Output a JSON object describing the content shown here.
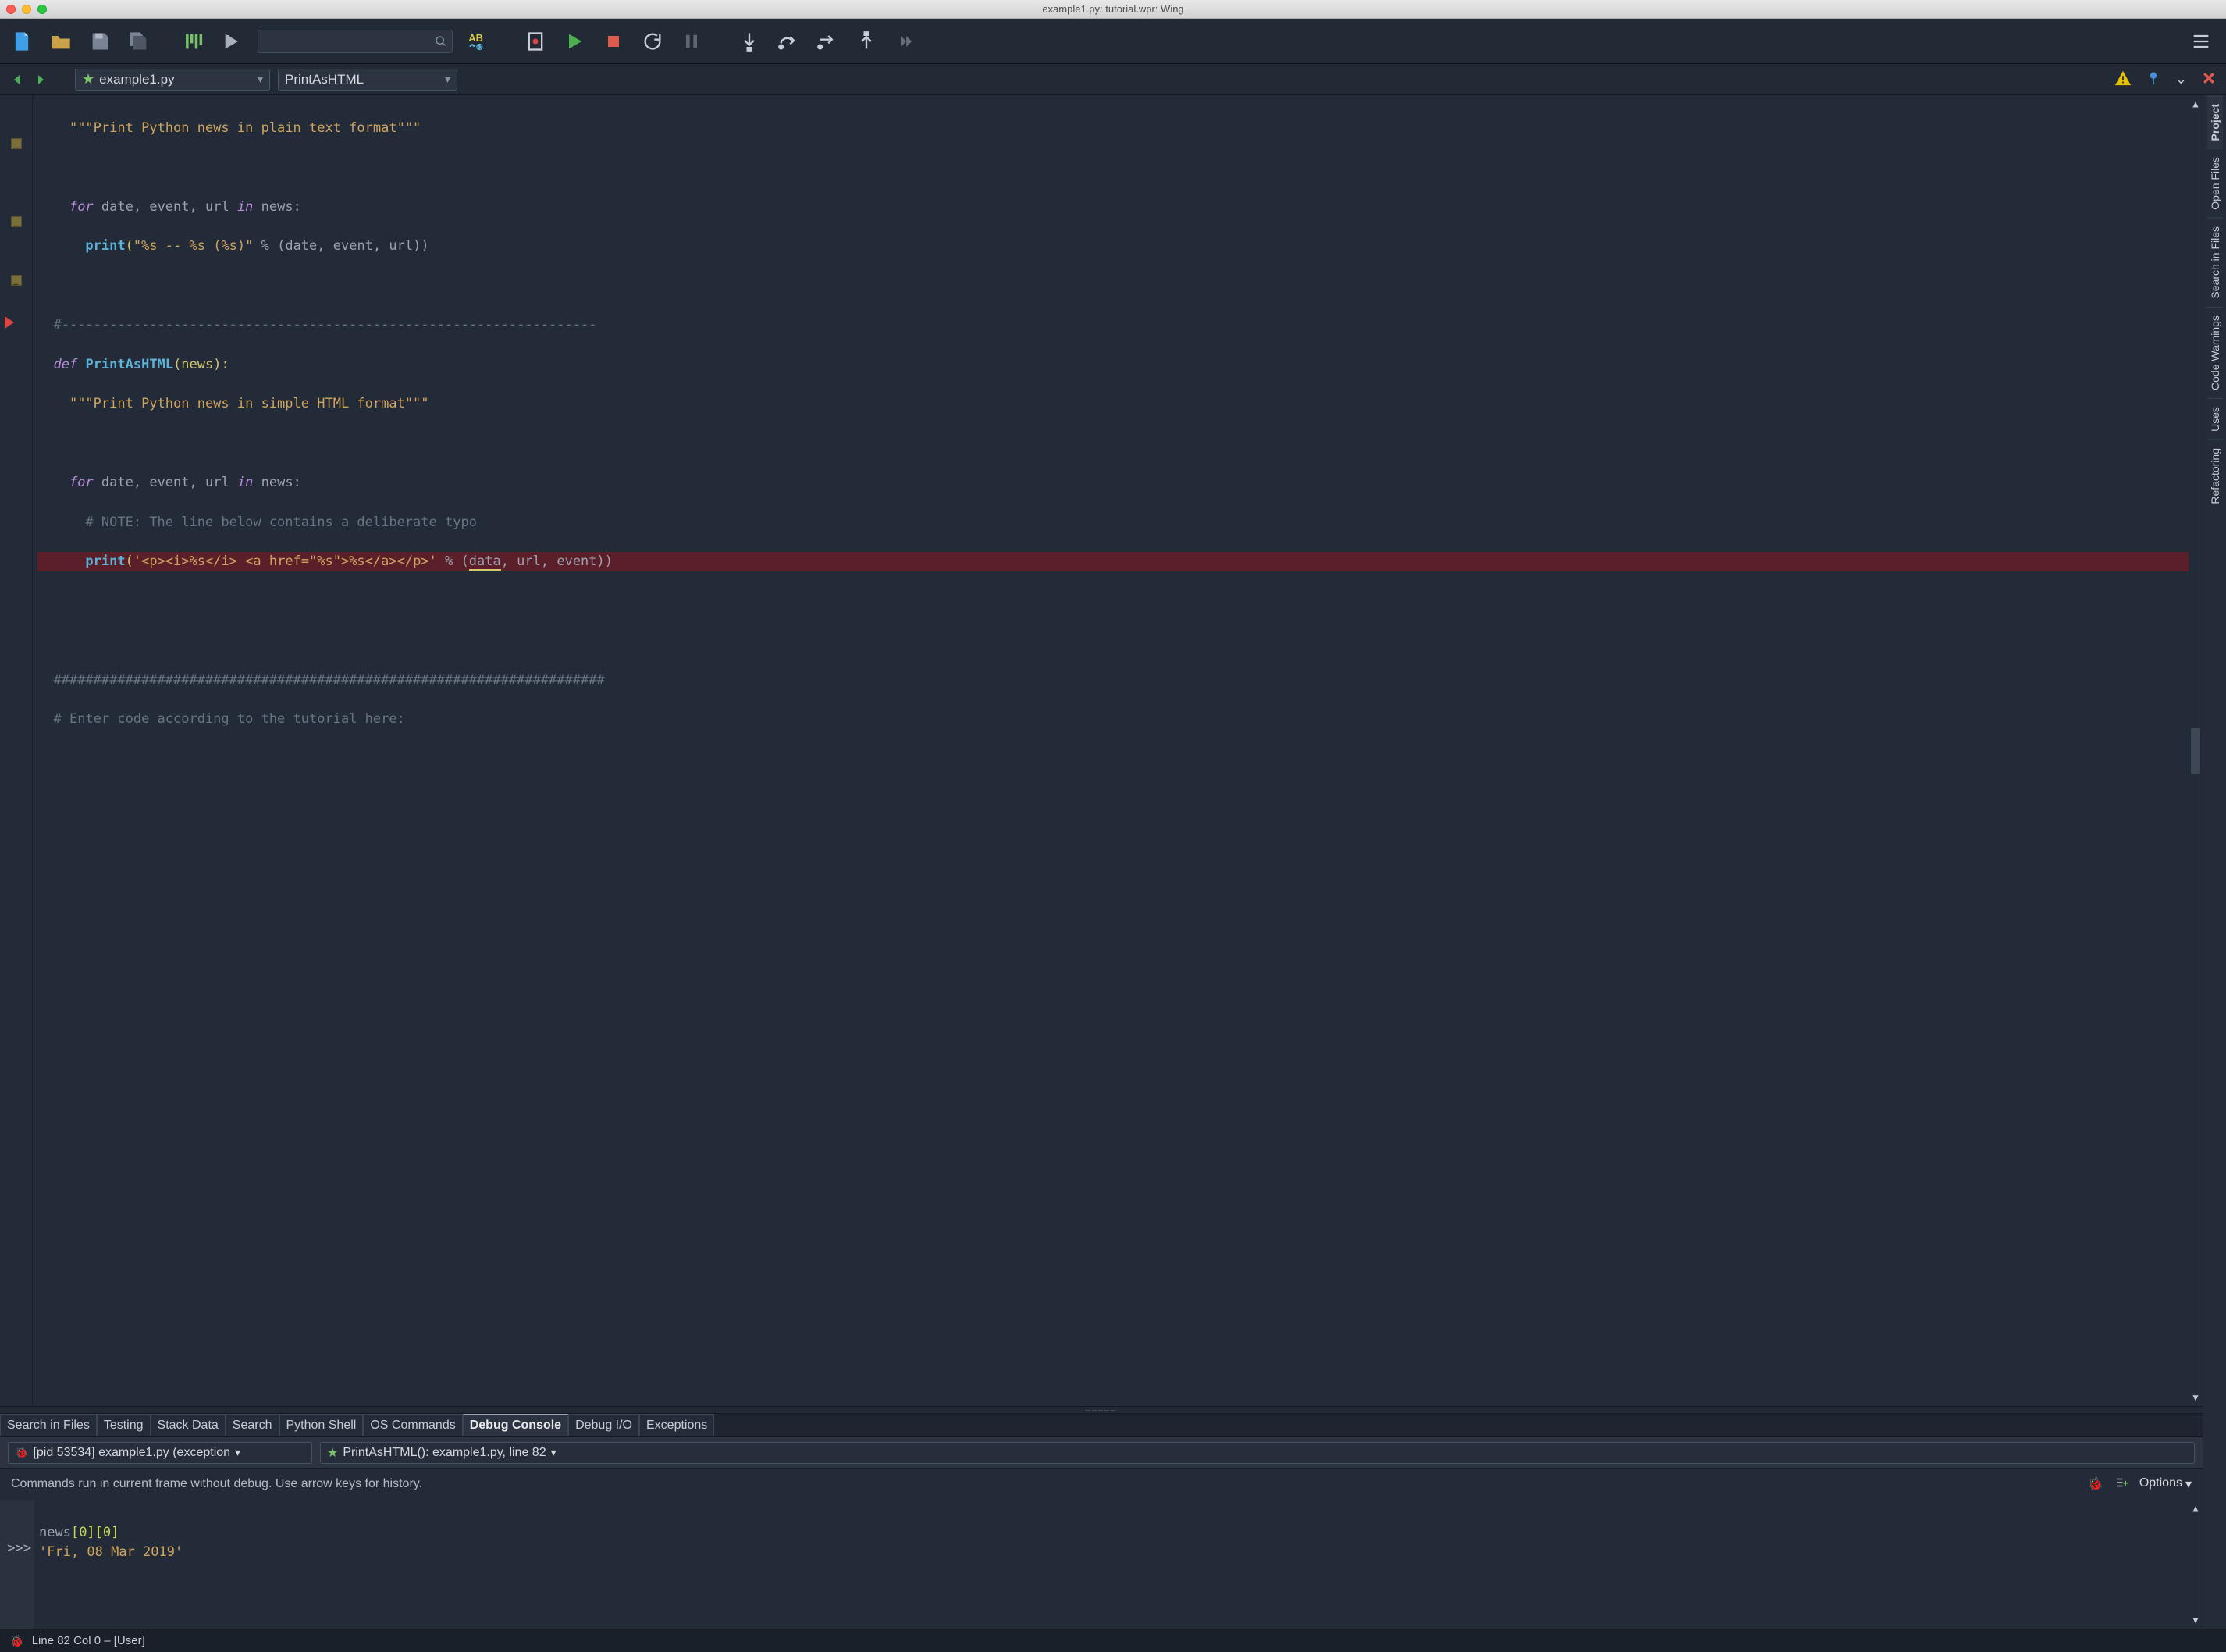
{
  "window": {
    "title": "example1.py: tutorial.wpr: Wing"
  },
  "nav": {
    "filename": "example1.py",
    "symbol": "PrintAsHTML"
  },
  "code": {
    "l1": "\"\"\"Print Python news in plain text format\"\"\"",
    "l3a": "for",
    "l3b": "date, event, url",
    "l3c": "in",
    "l3d": "news:",
    "l4a": "print",
    "l4b": "(",
    "l4c": "\"%s -- %s (%s)\"",
    "l4d": " % (date, event, url))",
    "l6": "#-------------------------------------------------------------------",
    "l7a": "def",
    "l7b": "PrintAsHTML",
    "l7c": "(news):",
    "l8": "\"\"\"Print Python news in simple HTML format\"\"\"",
    "l10a": "for",
    "l10b": "date, event, url",
    "l10c": "in",
    "l10d": "news:",
    "l11": "# NOTE: The line below contains a deliberate typo",
    "l12a": "print",
    "l12b": "(",
    "l12c": "'<p><i>%s</i> <a href=\"%s\">%s</a></p>'",
    "l12d": " % (",
    "l12e": "data",
    "l12f": ", url, event))",
    "l15": "#####################################################################",
    "l16": "# Enter code according to the tutorial here:"
  },
  "bottom_tabs": {
    "t0": "Search in Files",
    "t1": "Testing",
    "t2": "Stack Data",
    "t3": "Search",
    "t4": "Python Shell",
    "t5": "OS Commands",
    "t6": "Debug Console",
    "t7": "Debug I/O",
    "t8": "Exceptions"
  },
  "debug": {
    "process": "[pid 53534] example1.py (exception",
    "frame": "PrintAsHTML(): example1.py, line 82",
    "info": "Commands run in current frame without debug.  Use arrow keys for history.",
    "options": "Options",
    "input": "news[0][0]",
    "idx1": "[0]",
    "idx2": "[0]",
    "input_base": "news",
    "result": "'Fri, 08 Mar 2019'",
    "prompt": ">>>"
  },
  "side_tabs": {
    "t0": "Project",
    "t1": "Open Files",
    "t2": "Search in Files",
    "t3": "Code Warnings",
    "t4": "Uses",
    "t5": "Refactoring"
  },
  "status": {
    "text": "Line 82 Col 0 – [User]"
  }
}
